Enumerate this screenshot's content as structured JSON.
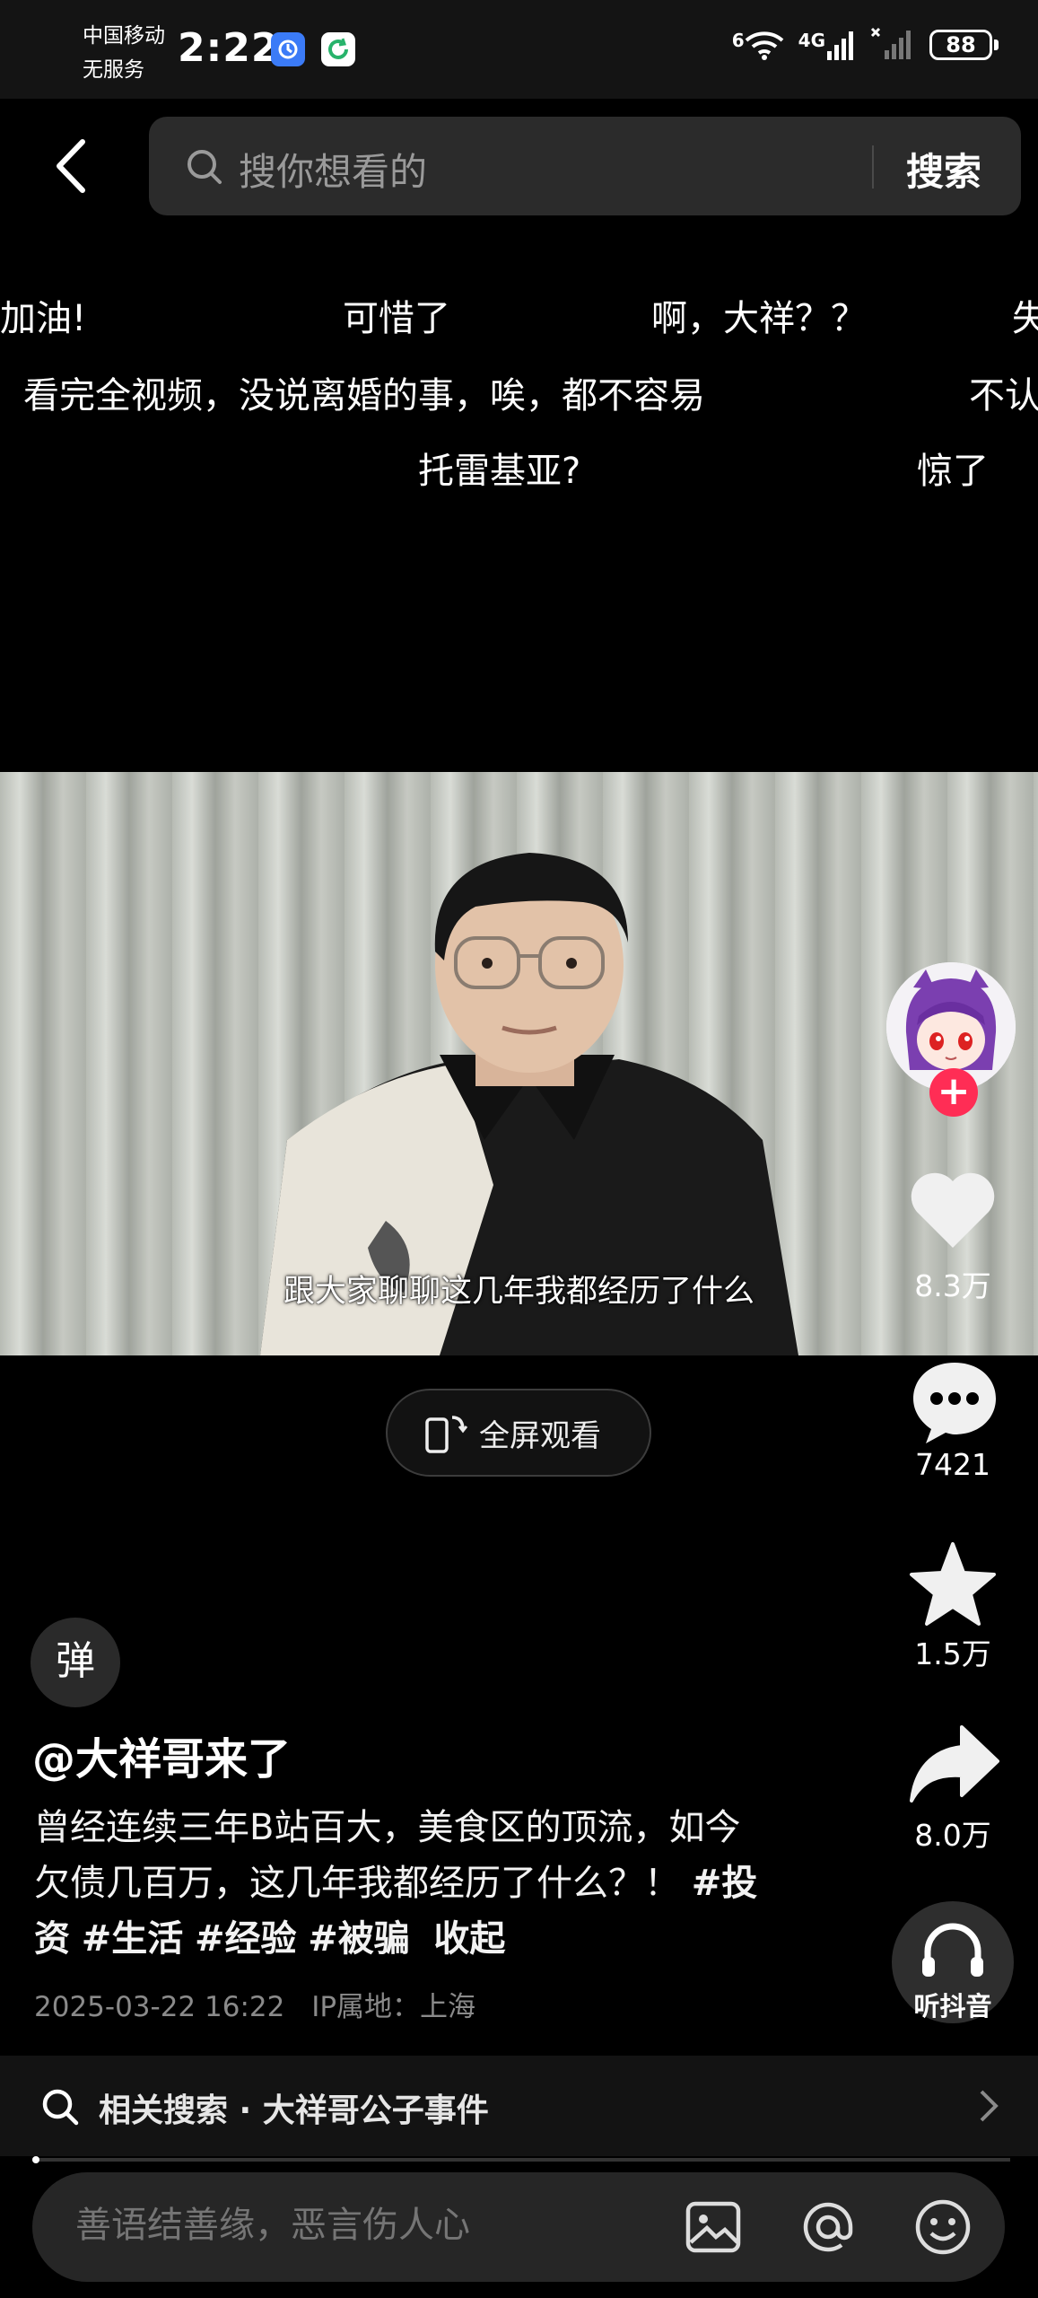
{
  "status_bar": {
    "carrier_line1": "中国移动",
    "carrier_line2": "无服务",
    "time": "2:22",
    "network_wifi": "6",
    "network_cell": "4G",
    "battery": "88"
  },
  "search": {
    "placeholder": "搜你想看的",
    "button_label": "搜索"
  },
  "danmaku": [
    "加油!",
    "可惜了",
    "啊，大祥？？",
    "失",
    "看完全视频，没说离婚的事，唉，都不容易",
    "不认",
    "托雷基亚?",
    "惊了"
  ],
  "video": {
    "subtitle": "跟大家聊聊这几年我都经历了什么",
    "fullscreen_label": "全屏观看"
  },
  "actions": {
    "likes": "8.3万",
    "comments": "7421",
    "favorites": "1.5万",
    "shares": "8.0万",
    "listen_label": "听抖音"
  },
  "post": {
    "danmu_toggle": "弹",
    "author": "@大祥哥来了",
    "description": "曾经连续三年B站百大，美食区的顶流，如今欠债几百万，这几年我都经历了什么？！",
    "tags": [
      "#投资",
      "#生活",
      "#经验",
      "#被骗"
    ],
    "collapse_label": "收起",
    "date": "2025-03-22 16:22",
    "ip_location": "IP属地：上海"
  },
  "related": {
    "label": "相关搜索 · 大祥哥公子事件"
  },
  "comment": {
    "placeholder": "善语结善缘，恶言伤人心"
  },
  "colors": {
    "background": "#000000",
    "follow_accent": "#ff2d55",
    "secondary_text": "#8a8a8a"
  }
}
